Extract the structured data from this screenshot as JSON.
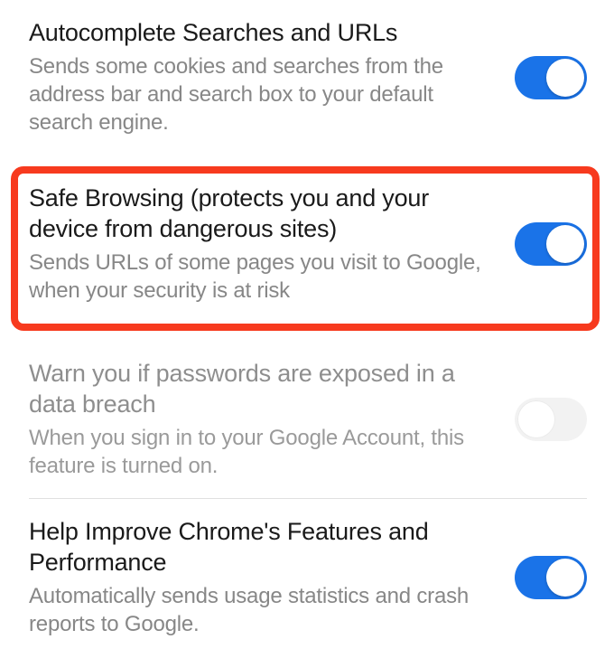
{
  "settings": [
    {
      "id": "autocomplete",
      "title": "Autocomplete Searches and URLs",
      "desc": "Sends some cookies and searches from the address bar and search box to your default search engine.",
      "on": true,
      "enabled": true
    },
    {
      "id": "safe-browsing",
      "title": "Safe Browsing (protects you and your device from dangerous sites)",
      "desc": "Sends URLs of some pages you visit to Google, when your security is at risk",
      "on": true,
      "enabled": true,
      "highlighted": true
    },
    {
      "id": "password-breach",
      "title": "Warn you if passwords are exposed in a data breach",
      "desc": "When you sign in to your Google Account, this feature is turned on.",
      "on": false,
      "enabled": false
    },
    {
      "id": "improve-chrome",
      "title": "Help Improve Chrome's Features and Performance",
      "desc": "Automatically sends usage statistics and crash reports to Google.",
      "on": true,
      "enabled": true
    }
  ]
}
